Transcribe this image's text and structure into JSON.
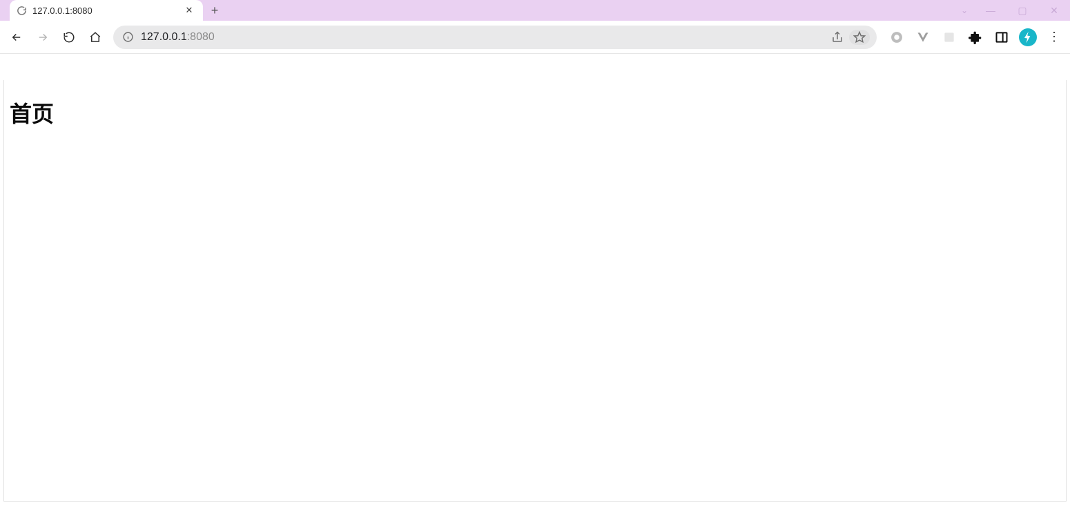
{
  "window": {
    "minimize_glyph": "—",
    "maximize_glyph": "▢",
    "close_glyph": "✕"
  },
  "tabstrip": {
    "active_tab_title": "127.0.0.1:8080",
    "close_glyph": "✕",
    "new_tab_glyph": "+",
    "tabs_caret_glyph": "⌄"
  },
  "toolbar": {
    "url_host": "127.0.0.1",
    "url_port": ":8080"
  },
  "icons": {
    "share": "share-icon",
    "star": "star-icon",
    "circle": "circle-icon",
    "vue": "vue-icon",
    "square_texture": "texture-icon",
    "puzzle": "extensions-icon",
    "panel": "side-panel-icon"
  },
  "page": {
    "heading": "首页"
  }
}
